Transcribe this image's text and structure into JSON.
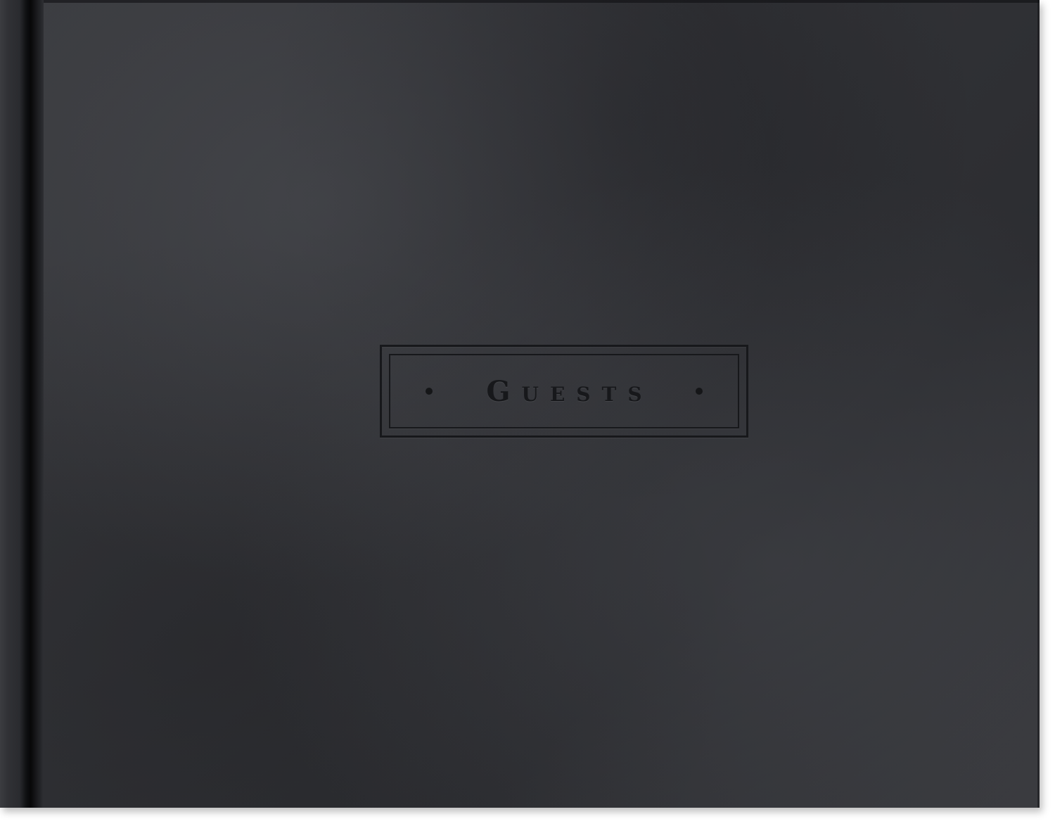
{
  "cover": {
    "title": "Guests",
    "color": "#333438",
    "emboss_color": "#17181b"
  }
}
